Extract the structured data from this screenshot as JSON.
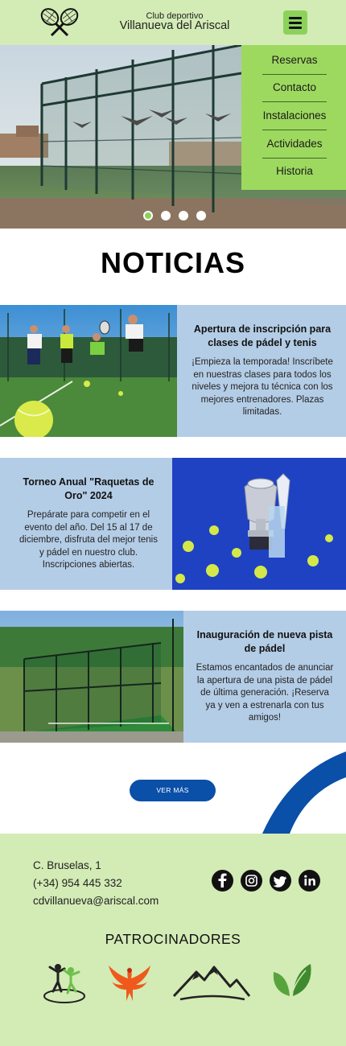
{
  "header": {
    "club_label": "Club deportivo",
    "club_name": "Villanueva del Ariscal",
    "logo_icon": "tennis-rackets-icon",
    "menu_icon": "hamburger-menu-icon"
  },
  "menu": {
    "items": [
      "Reservas",
      "Contacto",
      "Instalaciones",
      "Actividades",
      "Historia"
    ]
  },
  "carousel": {
    "slides": 4,
    "active_index": 0
  },
  "section_title": "NOTICIAS",
  "news": [
    {
      "title": "Apertura de inscripción para clases de pádel y tenis",
      "body": "¡Empieza la temporada! Inscríbete en nuestras clases para todos los niveles y mejora tu técnica con los mejores entrenadores. Plazas limitadas."
    },
    {
      "title": "Torneo Anual \"Raquetas de Oro\" 2024",
      "body": "Prepárate para competir en el evento del año. Del 15 al 17 de diciembre, disfruta del mejor tenis y pádel en nuestro club. Inscripciones abiertas."
    },
    {
      "title": "Inauguración de nueva pista de pádel",
      "body": "Estamos encantados de anunciar la apertura de una pista de pádel de última generación. ¡Reserva ya y ven a estrenarla con tus amigos!"
    }
  ],
  "more_button": "VER MÁS",
  "footer": {
    "address": "C. Bruselas, 1",
    "phone": "(+34) 954 445 332",
    "email": "cdvillanueva@ariscal.com",
    "social_icons": [
      "facebook-icon",
      "instagram-icon",
      "twitter-icon",
      "linkedin-icon"
    ],
    "sponsors_title": "PATROCINADORES",
    "sponsor_logos": [
      "people-sponsor-logo",
      "phoenix-sponsor-logo",
      "mountains-sponsor-logo",
      "leaf-sponsor-logo"
    ]
  },
  "colors": {
    "header_bg": "#d3ebb5",
    "menu_bg": "#9dd95f",
    "accent_green": "#8cd25a",
    "news_bg": "#b4cde6",
    "button_blue": "#0a4fa8"
  }
}
